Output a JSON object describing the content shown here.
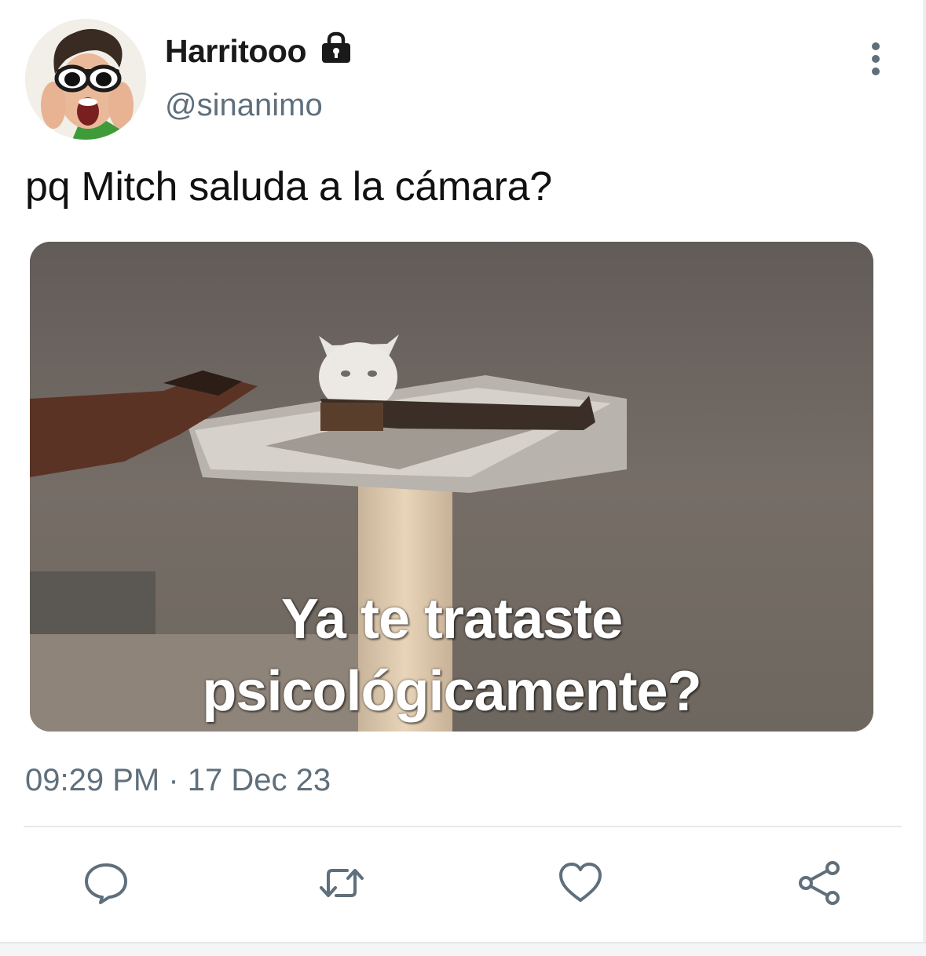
{
  "author": {
    "display_name": "Harritooo",
    "handle": "@sinanimo",
    "verified_icon": "lock-icon",
    "avatar": "avatar-photo"
  },
  "tweet": {
    "text": "pq Mitch saluda a la cámara?",
    "media": {
      "caption_line1": "Ya te trataste",
      "caption_line2": "psicológicamente?"
    },
    "timestamp": "09:29 PM · 17 Dec 23"
  },
  "actions": [
    {
      "icon": "reply-icon"
    },
    {
      "icon": "retweet-icon"
    },
    {
      "icon": "like-icon"
    },
    {
      "icon": "share-icon"
    }
  ],
  "colors": {
    "secondary_text": "#5f6f7b",
    "primary_text": "#111111",
    "icon_stroke": "#5f6f7b",
    "divider": "#e6eaed"
  }
}
